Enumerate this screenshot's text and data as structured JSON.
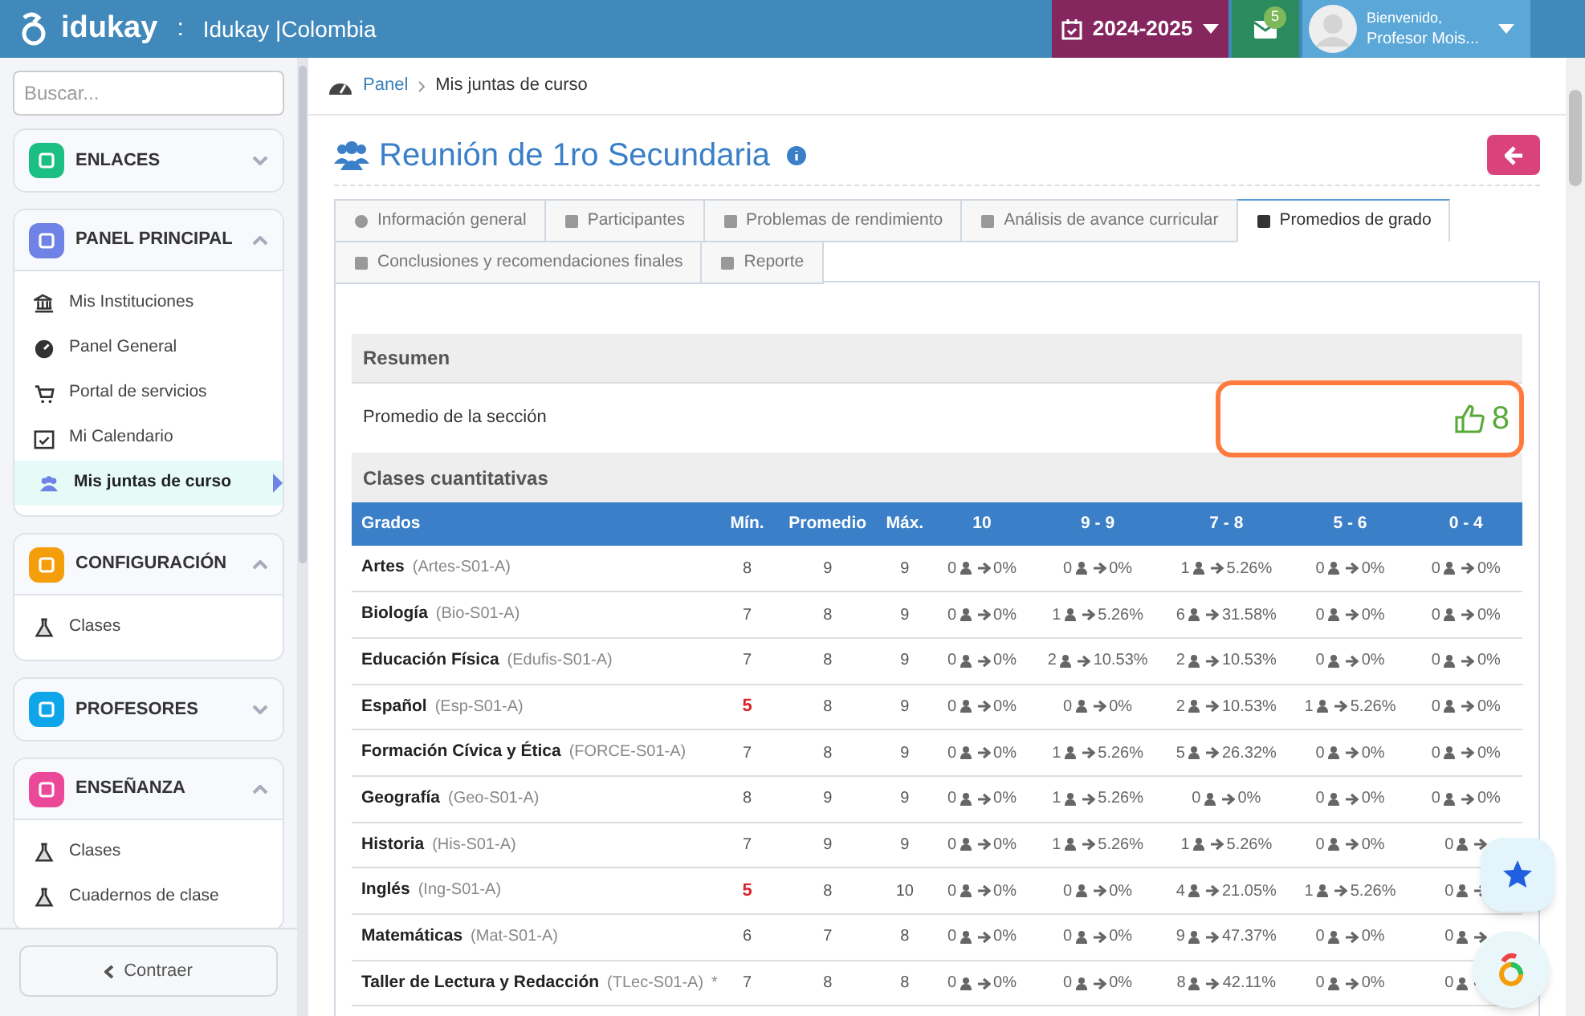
{
  "header": {
    "brand": "idukay",
    "separator": ":",
    "school": "Idukay |Colombia",
    "year": "2024-2025",
    "mail_count": "5",
    "greeting": "Bienvenido,",
    "user": "Profesor Mois..."
  },
  "sidebar": {
    "search_placeholder": "Buscar...",
    "collapse": "Contraer",
    "sections": [
      {
        "title": "ENLACES",
        "color": "#1cbf83",
        "expanded": false
      },
      {
        "title": "PANEL PRINCIPAL",
        "color": "#6f83e6",
        "expanded": true,
        "items": [
          {
            "label": "Mis Instituciones",
            "selected": false
          },
          {
            "label": "Panel General",
            "selected": false
          },
          {
            "label": "Portal de servicios",
            "selected": false
          },
          {
            "label": "Mi Calendario",
            "selected": false
          },
          {
            "label": "Mis juntas de curso",
            "selected": true
          }
        ]
      },
      {
        "title": "CONFIGURACIÓN",
        "color": "#f59e0b",
        "expanded": true,
        "items": [
          {
            "label": "Clases",
            "selected": false
          }
        ]
      },
      {
        "title": "PROFESORES",
        "color": "#0ea5e9",
        "expanded": false
      },
      {
        "title": "ENSEÑANZA",
        "color": "#ec4899",
        "expanded": true,
        "items": [
          {
            "label": "Clases",
            "selected": false
          },
          {
            "label": "Cuadernos de clase",
            "selected": false
          }
        ]
      }
    ]
  },
  "breadcrumb": [
    "Panel",
    "Mis juntas de curso"
  ],
  "page_title": "Reunión de 1ro Secundaria",
  "tabs": [
    {
      "label": "Información general",
      "selected": false
    },
    {
      "label": "Participantes",
      "selected": false
    },
    {
      "label": "Problemas de rendimiento",
      "selected": false
    },
    {
      "label": "Análisis de avance curricular",
      "selected": false
    },
    {
      "label": "Promedios de grado",
      "selected": true
    },
    {
      "label": "Conclusiones y recomendaciones finales",
      "selected": false
    },
    {
      "label": "Reporte",
      "selected": false
    }
  ],
  "summary": {
    "title": "Resumen",
    "label": "Promedio de la sección",
    "value": "8",
    "section_title": "Clases cuantitativas"
  },
  "table": {
    "columns": [
      "Grados",
      "Mín.",
      "Promedio",
      "Máx.",
      "10",
      "9 - 9",
      "7 - 8",
      "5 - 6",
      "0 - 4"
    ],
    "rows": [
      {
        "name": "Artes",
        "code": "(Artes-S01-A)",
        "note": "",
        "min": "8",
        "min_alert": false,
        "avg": "9",
        "max": "9",
        "buckets": [
          {
            "count": "0",
            "pct": "0%"
          },
          {
            "count": "0",
            "pct": "0%"
          },
          {
            "count": "1",
            "pct": "5.26%"
          },
          {
            "count": "0",
            "pct": "0%"
          },
          {
            "count": "0",
            "pct": "0%"
          }
        ]
      },
      {
        "name": "Biología",
        "code": "(Bio-S01-A)",
        "note": "",
        "min": "7",
        "min_alert": false,
        "avg": "8",
        "max": "9",
        "buckets": [
          {
            "count": "0",
            "pct": "0%"
          },
          {
            "count": "1",
            "pct": "5.26%"
          },
          {
            "count": "6",
            "pct": "31.58%"
          },
          {
            "count": "0",
            "pct": "0%"
          },
          {
            "count": "0",
            "pct": "0%"
          }
        ]
      },
      {
        "name": "Educación Física",
        "code": "(Edufis-S01-A)",
        "note": "",
        "min": "7",
        "min_alert": false,
        "avg": "8",
        "max": "9",
        "buckets": [
          {
            "count": "0",
            "pct": "0%"
          },
          {
            "count": "2",
            "pct": "10.53%"
          },
          {
            "count": "2",
            "pct": "10.53%"
          },
          {
            "count": "0",
            "pct": "0%"
          },
          {
            "count": "0",
            "pct": "0%"
          }
        ]
      },
      {
        "name": "Español",
        "code": "(Esp-S01-A)",
        "note": "",
        "min": "5",
        "min_alert": true,
        "avg": "8",
        "max": "9",
        "buckets": [
          {
            "count": "0",
            "pct": "0%"
          },
          {
            "count": "0",
            "pct": "0%"
          },
          {
            "count": "2",
            "pct": "10.53%"
          },
          {
            "count": "1",
            "pct": "5.26%"
          },
          {
            "count": "0",
            "pct": "0%"
          }
        ]
      },
      {
        "name": "Formación Cívica y Ética",
        "code": "(FORCE-S01-A)",
        "note": "",
        "min": "7",
        "min_alert": false,
        "avg": "8",
        "max": "9",
        "buckets": [
          {
            "count": "0",
            "pct": "0%"
          },
          {
            "count": "1",
            "pct": "5.26%"
          },
          {
            "count": "5",
            "pct": "26.32%"
          },
          {
            "count": "0",
            "pct": "0%"
          },
          {
            "count": "0",
            "pct": "0%"
          }
        ]
      },
      {
        "name": "Geografía",
        "code": "(Geo-S01-A)",
        "note": "",
        "min": "8",
        "min_alert": false,
        "avg": "9",
        "max": "9",
        "buckets": [
          {
            "count": "0",
            "pct": "0%"
          },
          {
            "count": "1",
            "pct": "5.26%"
          },
          {
            "count": "0",
            "pct": "0%"
          },
          {
            "count": "0",
            "pct": "0%"
          },
          {
            "count": "0",
            "pct": "0%"
          }
        ]
      },
      {
        "name": "Historia",
        "code": "(His-S01-A)",
        "note": "",
        "min": "7",
        "min_alert": false,
        "avg": "9",
        "max": "9",
        "buckets": [
          {
            "count": "0",
            "pct": "0%"
          },
          {
            "count": "1",
            "pct": "5.26%"
          },
          {
            "count": "1",
            "pct": "5.26%"
          },
          {
            "count": "0",
            "pct": "0%"
          },
          {
            "count": "0"
          }
        ]
      },
      {
        "name": "Inglés",
        "code": "(Ing-S01-A)",
        "note": "",
        "min": "5",
        "min_alert": true,
        "avg": "8",
        "max": "10",
        "buckets": [
          {
            "count": "0",
            "pct": "0%"
          },
          {
            "count": "0",
            "pct": "0%"
          },
          {
            "count": "4",
            "pct": "21.05%"
          },
          {
            "count": "1",
            "pct": "5.26%"
          },
          {
            "count": "0"
          }
        ]
      },
      {
        "name": "Matemáticas",
        "code": "(Mat-S01-A)",
        "note": "",
        "min": "6",
        "min_alert": false,
        "avg": "7",
        "max": "8",
        "buckets": [
          {
            "count": "0",
            "pct": "0%"
          },
          {
            "count": "0",
            "pct": "0%"
          },
          {
            "count": "9",
            "pct": "47.37%"
          },
          {
            "count": "0",
            "pct": "0%"
          },
          {
            "count": "0"
          }
        ]
      },
      {
        "name": "Taller de Lectura y Redacción",
        "code": "(TLec-S01-A)",
        "note": "*",
        "min": "7",
        "min_alert": false,
        "avg": "8",
        "max": "8",
        "buckets": [
          {
            "count": "0",
            "pct": "0%"
          },
          {
            "count": "0",
            "pct": "0%"
          },
          {
            "count": "8",
            "pct": "42.11%"
          },
          {
            "count": "0",
            "pct": "0%"
          },
          {
            "count": "0"
          }
        ]
      }
    ]
  }
}
